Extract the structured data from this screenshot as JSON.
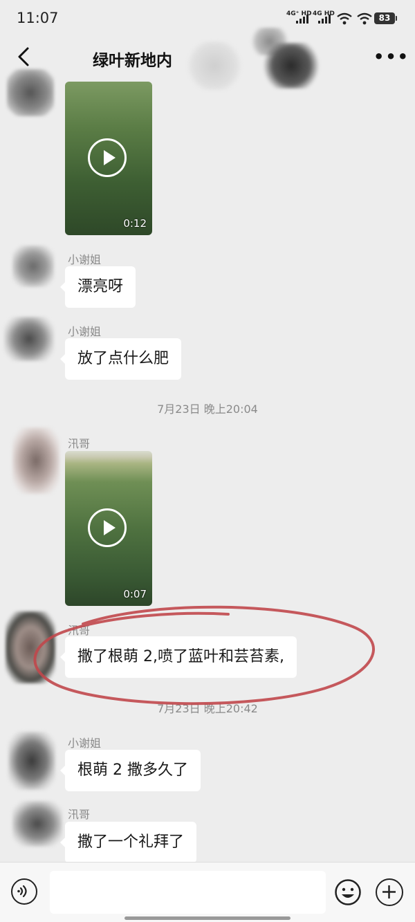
{
  "status_bar": {
    "time": "11:07",
    "signal1": "4G⁺ HD",
    "signal2": "4G HD",
    "battery": "83"
  },
  "nav": {
    "title": "绿叶新地内",
    "more_icon": "more-icon"
  },
  "messages": {
    "video1": {
      "duration": "0:12"
    },
    "m1": {
      "sender": "小谢姐",
      "text": "漂亮呀"
    },
    "m2": {
      "sender": "小谢姐",
      "text": "放了点什么肥"
    },
    "ts1": "7月23日 晚上20:04",
    "video2": {
      "sender": "汛哥",
      "duration": "0:07"
    },
    "m3": {
      "sender": "汛哥",
      "text": "撒了根萌 2,喷了蓝叶和芸苔素,"
    },
    "ts2": "7月23日 晚上20:42",
    "m4": {
      "sender": "小谢姐",
      "text": "根萌 2 撒多久了"
    },
    "m5": {
      "sender": "汛哥",
      "text": "撒了一个礼拜了"
    }
  },
  "annotation": {
    "color": "#c0474b"
  },
  "colors": {
    "background": "#ededed",
    "bubble": "#ffffff",
    "meta_text": "#8a8a8a"
  },
  "input_bar": {
    "voice_icon": "voice-icon",
    "emoji_icon": "emoji-icon",
    "plus_icon": "plus-icon"
  }
}
